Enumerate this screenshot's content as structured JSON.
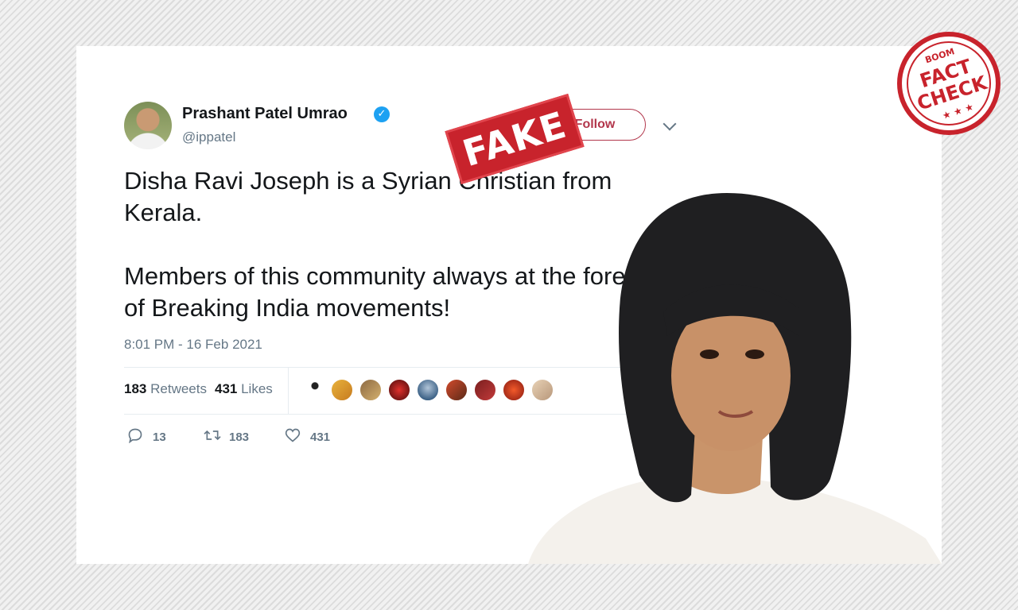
{
  "tweet": {
    "author_name": "Prashant Patel Umrao",
    "handle": "@ippatel",
    "verified_glyph": "✓",
    "follow_label": "Follow",
    "text_paragraphs": [
      "Disha Ravi Joseph is a Syrian Christian from Kerala.",
      "Members of this community always at the forefront of Breaking India movements!"
    ],
    "timestamp": "8:01 PM - 16 Feb 2021",
    "retweets_count": "183",
    "retweets_label": "Retweets",
    "likes_count": "431",
    "likes_label": "Likes",
    "actions": {
      "reply_count": "13",
      "retweet_count": "183",
      "like_count": "431"
    }
  },
  "overlays": {
    "fake_stamp": "FAKE",
    "fact_check_brand": "BOOM",
    "fact_check_line1": "FACT",
    "fact_check_line2": "CHECK"
  },
  "icons": {
    "reply": "reply-icon",
    "retweet": "retweet-icon",
    "like": "heart-icon",
    "menu": "chevron-down-icon"
  },
  "colors": {
    "twitter_blue": "#1da1f2",
    "brand_red": "#c8232c",
    "text_primary": "#14171a",
    "text_secondary": "#657786"
  }
}
